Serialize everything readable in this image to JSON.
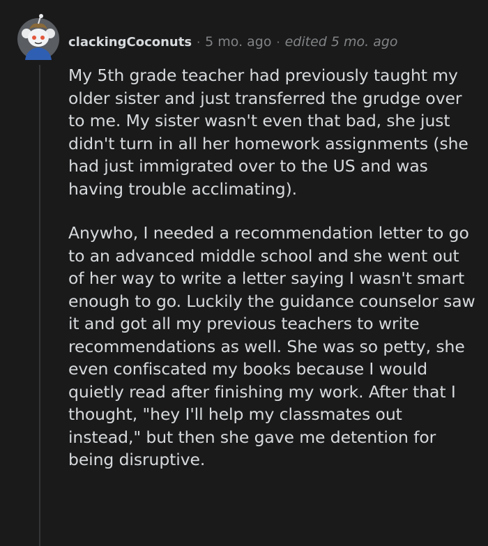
{
  "comment": {
    "author": "clackingCoconuts",
    "separator": "·",
    "age": "5 mo. ago",
    "edited": "edited 5 mo. ago",
    "paragraphs": [
      "My 5th grade teacher had previously taught my older sister and just transferred the grudge over to me. My sister wasn't even that bad, she just didn't turn in all her homework assignments (she had just immigrated over to the US and was having trouble acclimating).",
      "Anywho, I needed a recommendation letter to go to an advanced middle school and she went out of her way to write a letter saying I wasn't smart enough to go. Luckily the guidance counselor saw it and got all my previous teachers to write recommendations as well. She was so petty, she even confiscated my books because I would quietly read after finishing my work. After that I thought, \"hey I'll help my classmates out instead,\" but then she gave me detention for being disruptive."
    ]
  },
  "colors": {
    "background": "#1a1a1b",
    "text": "#d7dadc",
    "meta": "#818384",
    "thread_line": "#343536"
  },
  "icons": {
    "avatar": "snoo-avatar"
  }
}
